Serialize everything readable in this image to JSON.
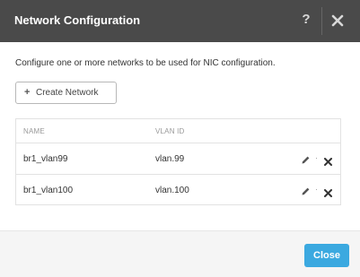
{
  "dialog": {
    "title": "Network Configuration",
    "help_label": "?",
    "description": "Configure one or more networks to be used for NIC configuration.",
    "create_button_label": "Create Network",
    "table": {
      "headers": {
        "name": "NAME",
        "vlan": "VLAN ID"
      },
      "rows": [
        {
          "name": "br1_vlan99",
          "vlan": "vlan.99"
        },
        {
          "name": "br1_vlan100",
          "vlan": "vlan.100"
        }
      ],
      "action_separator": "·"
    },
    "close_button_label": "Close"
  },
  "icons": {
    "help": "help-icon",
    "close": "close-icon",
    "plus": "plus-icon",
    "edit": "pencil-icon",
    "remove": "x-icon"
  },
  "colors": {
    "header_bg": "#4a4a4a",
    "primary": "#3ba9e0",
    "footer_bg": "#f5f5f5"
  }
}
